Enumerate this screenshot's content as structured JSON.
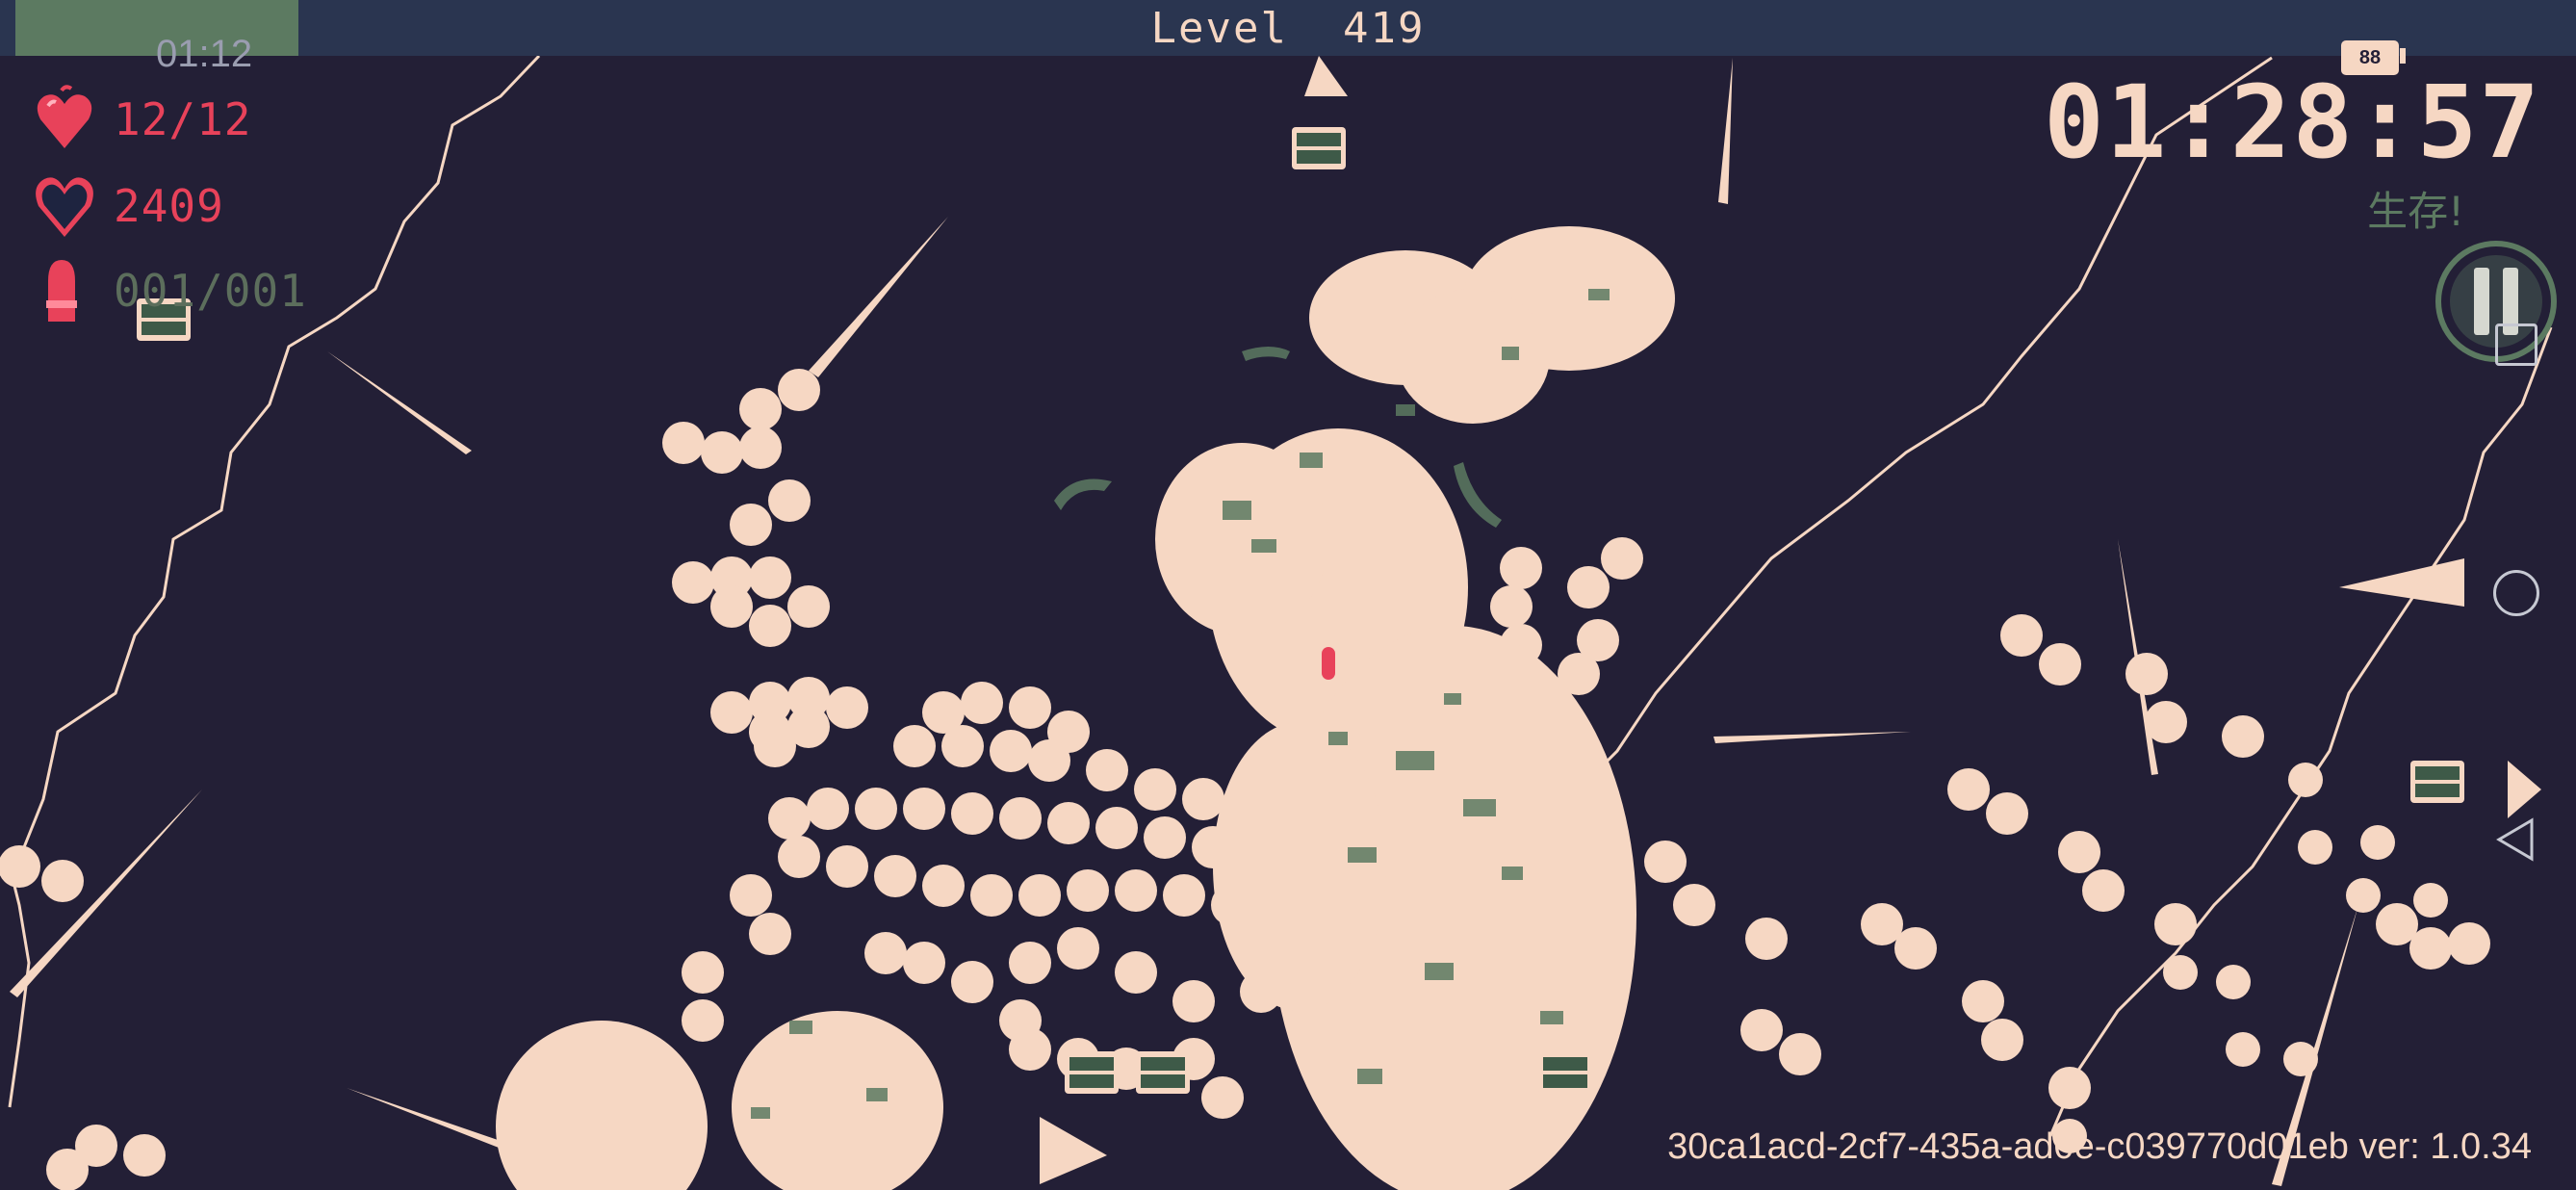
{
  "hud": {
    "level_label": "Level",
    "level_value": "419",
    "xp_timer": "01:12",
    "xp_progress": 0.11,
    "health": "12/12",
    "gems": "2409",
    "ammo": "001/001",
    "battery": "88",
    "survival_timer": "01:28:57",
    "mode_label": "生存!",
    "build_info": "30ca1acd-2cf7-435a-ad0e-c039770d01eb ver: 1.0.34"
  },
  "colors": {
    "background": "#231f36",
    "enemy": "#f6d7c3",
    "accent_red": "#e8425a",
    "moss": "#5c7a61",
    "xp_bar": "#2a3550"
  },
  "icons": {
    "health": "heart-icon",
    "gems": "dark-heart-icon",
    "ammo": "bullet-icon",
    "pause": "pause-icon",
    "chest": "treasure-chest-icon"
  }
}
